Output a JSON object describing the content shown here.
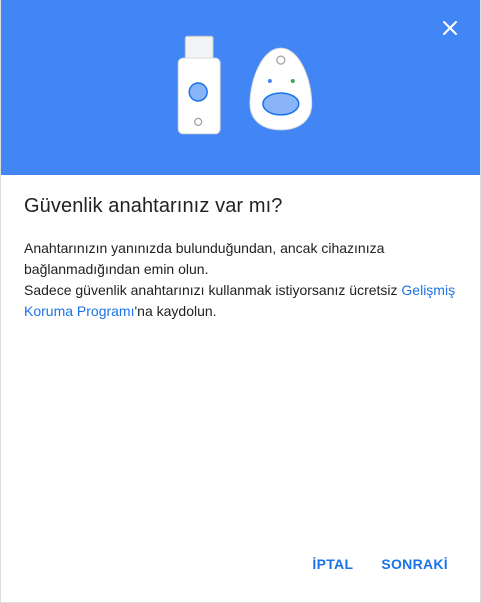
{
  "dialog": {
    "title": "Güvenlik anahtarınız var mı?",
    "line1": "Anahtarınızın yanınızda bulunduğundan, ancak cihazınıza bağlanmadığından emin olun.",
    "line2_prefix": "Sadece güvenlik anahtarınızı kullanmak istiyorsanız ücretsiz ",
    "link_text": "Gelişmiş Koruma Programı",
    "line2_suffix": "'na kaydolun.",
    "cancel_label": "İPTAL",
    "next_label": "SONRAKİ"
  },
  "colors": {
    "hero": "#4285f4",
    "accent": "#1a73e8"
  },
  "icons": {
    "close": "close-icon",
    "usb_key": "usb-security-key-icon",
    "fob_key": "bluetooth-security-key-icon"
  }
}
